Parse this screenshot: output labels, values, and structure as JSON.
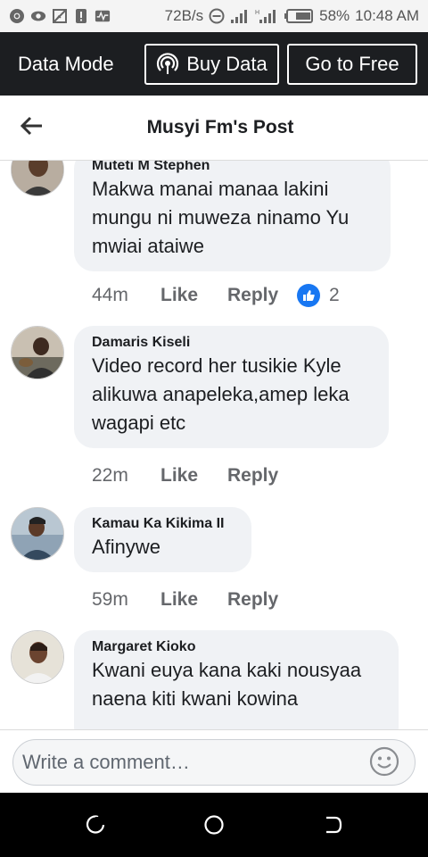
{
  "status_bar": {
    "speed": "72B/s",
    "battery": "58%",
    "time": "10:48 AM"
  },
  "data_bar": {
    "mode_label": "Data Mode",
    "buy_data_label": "Buy Data",
    "go_free_label": "Go to Free"
  },
  "header": {
    "title": "Musyi Fm's Post"
  },
  "comments": [
    {
      "name": "Muteti M Stephen",
      "lines": [
        "Makwa manai manaa lakini",
        "mungu ni muweza ninamo Yu",
        "mwiai ataiwe"
      ],
      "time": "44m",
      "like": "Like",
      "reply": "Reply",
      "reaction_count": "2"
    },
    {
      "name": "Damaris Kiseli",
      "lines": [
        "Video record her tusikie Kyle",
        "alikuwa anapeleka,amep leka",
        "wagapi etc"
      ],
      "time": "22m",
      "like": "Like",
      "reply": "Reply"
    },
    {
      "name": "Kamau Ka Kikima II",
      "lines": [
        "Afinywe"
      ],
      "time": "59m",
      "like": "Like",
      "reply": "Reply"
    },
    {
      "name": "Margaret Kioko",
      "lines": [
        "Kwani euya kana kaki nousyaa",
        "naena kiti kwani kowina"
      ]
    }
  ],
  "composer": {
    "placeholder": "Write a comment…"
  },
  "colors": {
    "banner_bg": "#1c1e21",
    "bubble_bg": "#f0f2f5",
    "like_blue": "#1877f2"
  },
  "icons": [
    "chrome-icon",
    "vpn-icon",
    "image-off-icon",
    "sim-icon",
    "activity-icon",
    "do-not-disturb-icon",
    "signal-icon",
    "battery-icon",
    "broadcast-icon",
    "back-arrow-icon",
    "thumbs-up-icon",
    "emoji-icon",
    "recents-icon",
    "home-icon",
    "back-nav-icon"
  ]
}
